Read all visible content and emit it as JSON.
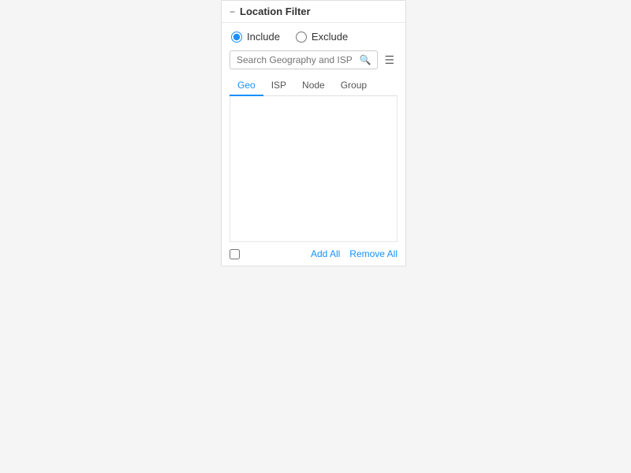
{
  "filter": {
    "title": "Location Filter",
    "collapse_icon": "−",
    "radio_options": [
      {
        "id": "include",
        "label": "Include",
        "checked": true
      },
      {
        "id": "exclude",
        "label": "Exclude",
        "checked": false
      }
    ],
    "search": {
      "placeholder": "Search Geography and ISP"
    },
    "tabs": [
      {
        "id": "geo",
        "label": "Geo",
        "active": true
      },
      {
        "id": "isp",
        "label": "ISP",
        "active": false
      },
      {
        "id": "node",
        "label": "Node",
        "active": false
      },
      {
        "id": "group",
        "label": "Group",
        "active": false
      }
    ],
    "footer": {
      "add_all_label": "Add All",
      "remove_all_label": "Remove All"
    }
  }
}
